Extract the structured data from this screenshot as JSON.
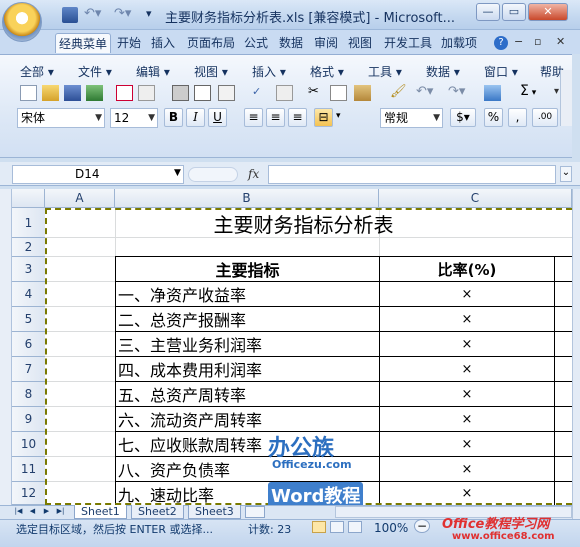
{
  "window": {
    "title": "主要财务指标分析表.xls  [兼容模式] - Microsoft...",
    "buttons": {
      "minimize": "—",
      "restore": "▭",
      "close": "✕"
    }
  },
  "ribbon_tabs": [
    "经典菜单",
    "开始",
    "插入",
    "页面布局",
    "公式",
    "数据",
    "审阅",
    "视图",
    "开发工具",
    "加载项"
  ],
  "ribbon_right_icons": [
    "help-icon",
    "minimize-ribbon-icon",
    "restore-workbook-icon",
    "close-workbook-icon"
  ],
  "menu": [
    "全部",
    "文件",
    "编辑",
    "视图",
    "插入",
    "格式",
    "工具",
    "数据",
    "窗口",
    "帮助"
  ],
  "toolbar": {
    "font_name": "宋体",
    "font_size": "12",
    "bold": "B",
    "italic": "I",
    "underline": "U",
    "number_format": "常规",
    "percent": "%",
    "comma": ",",
    "sigma": "Σ",
    "decimal": ".00"
  },
  "formula_bar": {
    "name_box": "D14",
    "fx": "fx",
    "value": ""
  },
  "columns": [
    "A",
    "B",
    "C"
  ],
  "rows": [
    "1",
    "2",
    "3",
    "4",
    "5",
    "6",
    "7",
    "8",
    "9",
    "10",
    "11",
    "12"
  ],
  "sheet": {
    "title": "主要财务指标分析表",
    "header": {
      "indicator": "主要指标",
      "ratio": "比率(%)"
    },
    "items": [
      {
        "name": "一、净资产收益率",
        "value": "×"
      },
      {
        "name": "二、总资产报酬率",
        "value": "×"
      },
      {
        "name": "三、主营业务利润率",
        "value": "×"
      },
      {
        "name": "四、成本费用利润率",
        "value": "×"
      },
      {
        "name": "五、总资产周转率",
        "value": "×"
      },
      {
        "name": "六、流动资产周转率",
        "value": "×"
      },
      {
        "name": "七、应收账款周转率",
        "value": "×"
      },
      {
        "name": "八、资产负债率",
        "value": "×"
      },
      {
        "name": "九、速动比率",
        "value": "×"
      }
    ]
  },
  "sheet_tabs": [
    "Sheet1",
    "Sheet2",
    "Sheet3"
  ],
  "status": {
    "message": "选定目标区域，然后按 ENTER 或选择...",
    "count": "计数: 23",
    "zoom": "100%",
    "zoom_minus": "−"
  },
  "watermarks": {
    "logo_text": "办公族",
    "logo_url": "Officezu.com",
    "word": "Word教程",
    "site": "Office教程学习网",
    "site_url": "www.office68.com"
  }
}
